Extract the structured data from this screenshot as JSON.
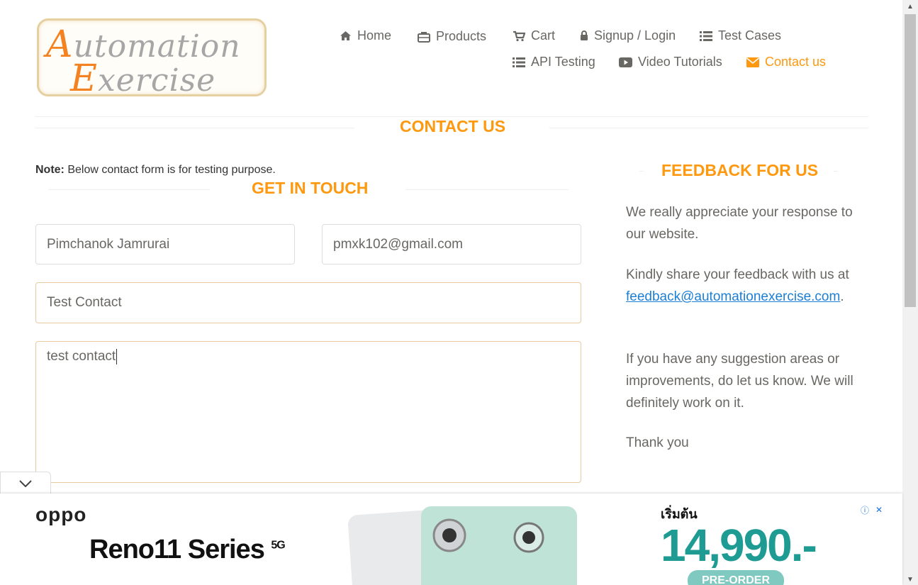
{
  "logo": {
    "line1_cap": "A",
    "line1_rest": "utomation",
    "line2_cap": "E",
    "line2_rest": "xercise"
  },
  "nav": {
    "home": "Home",
    "products": "Products",
    "cart": "Cart",
    "signup_login": "Signup / Login",
    "test_cases": "Test Cases",
    "api_testing": "API Testing",
    "video_tutorials": "Video Tutorials",
    "contact_us": "Contact us"
  },
  "page_title": "CONTACT US",
  "note": {
    "label": "Note:",
    "text": " Below contact form is for testing purpose."
  },
  "get_in_touch": "GET IN TOUCH",
  "form": {
    "name": "Pimchanok Jamrurai",
    "email": "pmxk102@gmail.com",
    "subject": "Test Contact",
    "message": "test contact"
  },
  "feedback": {
    "title": "FEEDBACK FOR US",
    "p1": "We really appreciate your response to our website.",
    "p2_before": "Kindly share your feedback with us at ",
    "p2_link": "feedback@automationexercise.com",
    "p2_after": ".",
    "p3": "If you have any suggestion areas or improvements, do let us know. We will definitely work on it.",
    "p4": "Thank you"
  },
  "ad": {
    "brand": "oppo",
    "product": "Reno11 Series",
    "product_sup": "5G",
    "price_prefix": "เริ่มต้น",
    "price": "14,990.-",
    "cta": "PRE-ORDER"
  },
  "colors": {
    "accent": "#fe980f",
    "link": "#1d7fd3",
    "text": "#696763"
  }
}
